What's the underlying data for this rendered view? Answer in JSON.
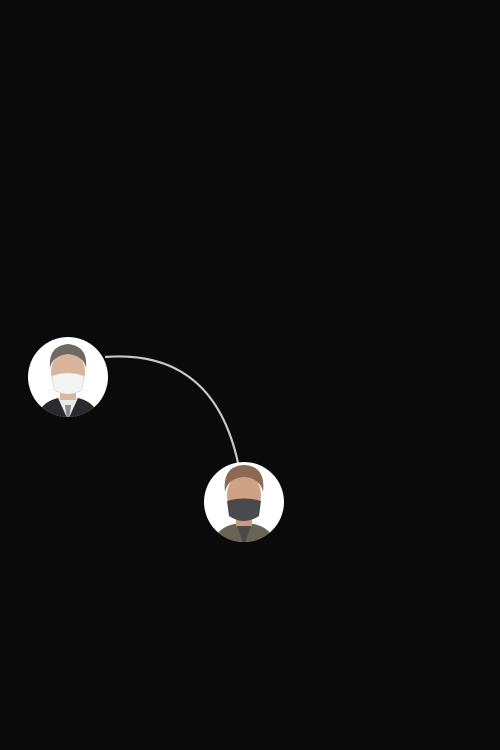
{
  "colors": {
    "background": "#0a0a0a",
    "connector": "#c8c8c8",
    "avatar_bg": "#ffffff"
  }
}
